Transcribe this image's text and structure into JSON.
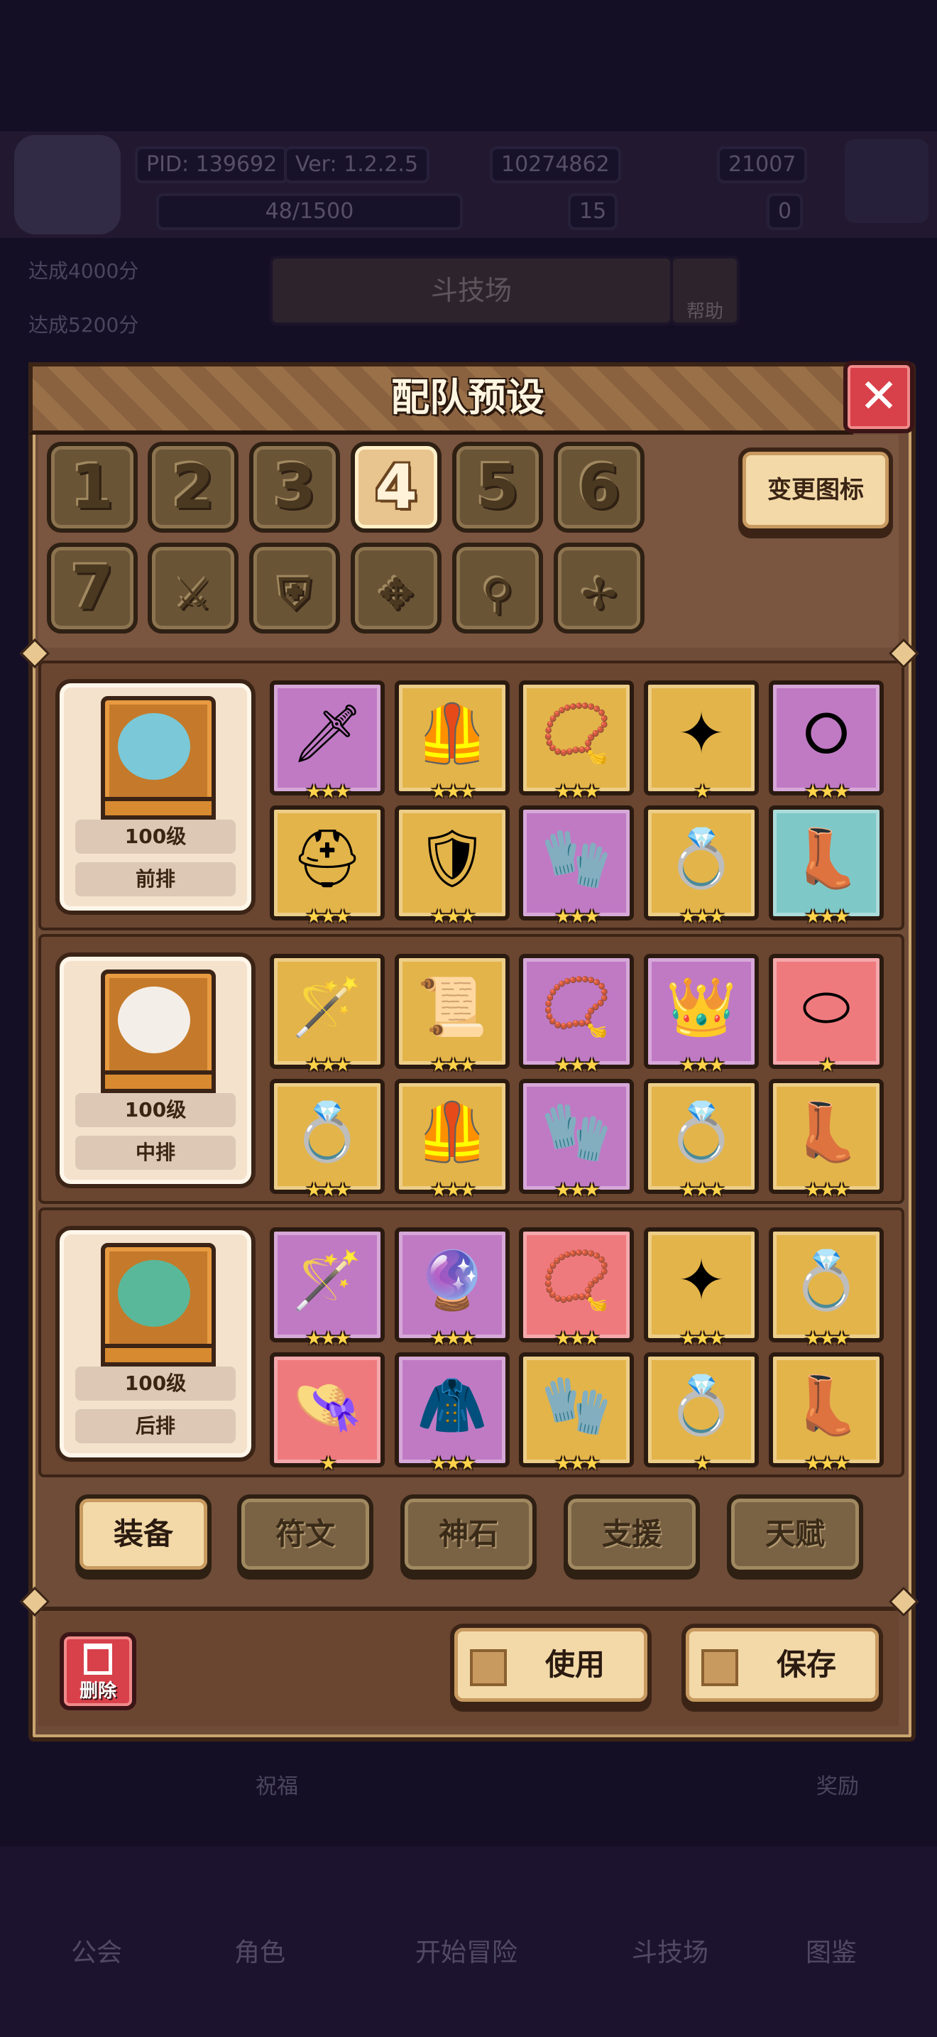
{
  "background": {
    "pid": "PID: 139692",
    "version": "Ver: 1.2.2.5",
    "gold": "10274862",
    "gems": "21007",
    "stamina": "48/1500",
    "clover": "15",
    "keys": "0",
    "task1": "达成4000分",
    "task2": "达成5200分",
    "arena_title": "斗技场",
    "help": "帮助",
    "blessing": "祝福",
    "reward": "奖励",
    "nav": [
      "公会",
      "角色",
      "开始冒险",
      "斗技场",
      "图鉴"
    ]
  },
  "modal": {
    "title": "配队预设",
    "change_icon": "变更图标",
    "presets": [
      "1",
      "2",
      "3",
      "4",
      "5",
      "6",
      "7"
    ],
    "preset_icons": [
      "sword-icon",
      "shield-icon",
      "cross-icon",
      "key-icon",
      "gear-icon"
    ],
    "active_preset": "4"
  },
  "characters": [
    {
      "level": "100级",
      "position": "前排",
      "items": [
        {
          "color": "purple",
          "icon": "🗡",
          "stars": "★★★"
        },
        {
          "color": "gold",
          "icon": "🦺",
          "stars": "★★★"
        },
        {
          "color": "gold",
          "icon": "📿",
          "stars": "★★★"
        },
        {
          "color": "gold",
          "icon": "✦",
          "stars": "★"
        },
        {
          "color": "purple",
          "icon": "⭘",
          "stars": "★★★"
        },
        {
          "color": "gold",
          "icon": "⛑",
          "stars": "★★★"
        },
        {
          "color": "gold",
          "icon": "🛡",
          "stars": "★★★"
        },
        {
          "color": "purple",
          "icon": "🧤",
          "stars": "★★★"
        },
        {
          "color": "gold",
          "icon": "💍",
          "stars": "★★★"
        },
        {
          "color": "teal",
          "icon": "👢",
          "stars": "★★★"
        }
      ]
    },
    {
      "level": "100级",
      "position": "中排",
      "items": [
        {
          "color": "gold",
          "icon": "🪄",
          "stars": "★★★"
        },
        {
          "color": "gold",
          "icon": "📜",
          "stars": "★★★"
        },
        {
          "color": "purple",
          "icon": "📿",
          "stars": "★★★"
        },
        {
          "color": "purple",
          "icon": "👑",
          "stars": "★★★"
        },
        {
          "color": "pink",
          "icon": "⬭",
          "stars": "★"
        },
        {
          "color": "gold",
          "icon": "💍",
          "stars": "★★★"
        },
        {
          "color": "gold",
          "icon": "🦺",
          "stars": "★★★"
        },
        {
          "color": "purple",
          "icon": "🧤",
          "stars": "★★★"
        },
        {
          "color": "gold",
          "icon": "💍",
          "stars": "★★★"
        },
        {
          "color": "gold",
          "icon": "👢",
          "stars": "★★★"
        }
      ]
    },
    {
      "level": "100级",
      "position": "后排",
      "items": [
        {
          "color": "purple",
          "icon": "🪄",
          "stars": "★★★"
        },
        {
          "color": "purple",
          "icon": "🔮",
          "stars": "★★★"
        },
        {
          "color": "pink",
          "icon": "📿",
          "stars": "★★★"
        },
        {
          "color": "gold",
          "icon": "✦",
          "stars": "★★★"
        },
        {
          "color": "gold",
          "icon": "💍",
          "stars": "★★★"
        },
        {
          "color": "pink",
          "icon": "👒",
          "stars": "★"
        },
        {
          "color": "purple",
          "icon": "🧥",
          "stars": "★★★"
        },
        {
          "color": "gold",
          "icon": "🧤",
          "stars": "★★★"
        },
        {
          "color": "gold",
          "icon": "💍",
          "stars": "★"
        },
        {
          "color": "gold",
          "icon": "👢",
          "stars": "★★★"
        }
      ]
    }
  ],
  "tabs": [
    "装备",
    "符文",
    "神石",
    "支援",
    "天赋"
  ],
  "active_tab": "装备",
  "actions": {
    "delete": "删除",
    "use": "使用",
    "save": "保存"
  }
}
